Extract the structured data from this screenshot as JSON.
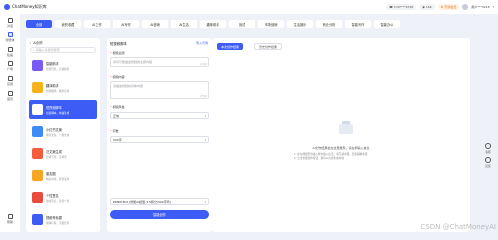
{
  "app": {
    "title": "ChatMoney知识库"
  },
  "topbar": {
    "phone": "139****6748",
    "balance": "166",
    "vip_badge": "开通会员",
    "user_name": "用户***3218"
  },
  "rail": {
    "items": [
      {
        "label": "对话"
      },
      {
        "label": "智能体"
      },
      {
        "label": "绘画"
      },
      {
        "label": "广场"
      },
      {
        "label": "应用"
      },
      {
        "label": "首页"
      },
      {
        "label": "帮助"
      }
    ]
  },
  "categories": [
    {
      "label": "全部",
      "active": true
    },
    {
      "label": "我的收藏"
    },
    {
      "label": "AI工作"
    },
    {
      "label": "AI写作"
    },
    {
      "label": "AI营销"
    },
    {
      "label": "AI生活"
    },
    {
      "label": "趣味助手"
    },
    {
      "label": "测试"
    },
    {
      "label": "市场营销"
    },
    {
      "label": "生活娱乐"
    },
    {
      "label": "商业分析"
    },
    {
      "label": "智能写作"
    },
    {
      "label": "智能办公"
    }
  ],
  "list": {
    "header": "AI创作",
    "search_placeholder": "请输入关键词搜索",
    "bots": [
      {
        "name": "智能助手",
        "desc": "智能回答，高效解答",
        "color": "#7a5af5"
      },
      {
        "name": "翻译助手",
        "desc": "智能翻译，精准高效",
        "color": "#f5b21b"
      },
      {
        "name": "短视频脚本",
        "desc": "创意脚本，快速生成",
        "color": "#ffffff",
        "active": true
      },
      {
        "name": "小红书文案",
        "desc": "爆款文案，一键生成",
        "color": "#3d8cf5"
      },
      {
        "name": "泛文案生成",
        "desc": "智能写作，多场景",
        "color": "#f55b3d"
      },
      {
        "name": "朋友圈",
        "desc": "精彩内容，轻松发布",
        "color": "#f5a623"
      },
      {
        "name": "个性签名",
        "desc": "独特签名，彰显个性",
        "color": "#e74c3c"
      },
      {
        "name": "视频号标题",
        "desc": "吸睛标题，流量密码",
        "color": "#3d5cf5"
      }
    ]
  },
  "form": {
    "title": "短视频脚本",
    "import_label": "导入示例",
    "fields": [
      {
        "label": "视频主题",
        "placeholder": "请尽可能描述视频的主题内容",
        "counter": "0/200"
      },
      {
        "label": "视频内容",
        "placeholder": "请描述视频的具体内容",
        "counter": "0/500"
      }
    ],
    "style_label": "视频风格",
    "style_value": "正常",
    "words_label": "字数",
    "words_value": "500字",
    "model_value": "ERNIE-Bot (智能AI模型-3.5积分/500字符)",
    "generate_label": "智能创作"
  },
  "result": {
    "tab_active": "本次创作结果",
    "tab_idle": "历史创作结果",
    "empty_title": "AI创作结果会在这里展现，请左侧输入信息",
    "empty_lines": [
      "1. 在左侧模型的输入框中输入信息，填写越详细，结果越精准哦",
      "2. 点击智能创作按钮，静待AI为您生成内容"
    ]
  },
  "float_tools": [
    {
      "label": "客服"
    },
    {
      "label": "反馈"
    }
  ],
  "watermark": "CSDN @ChatMoneyAI"
}
